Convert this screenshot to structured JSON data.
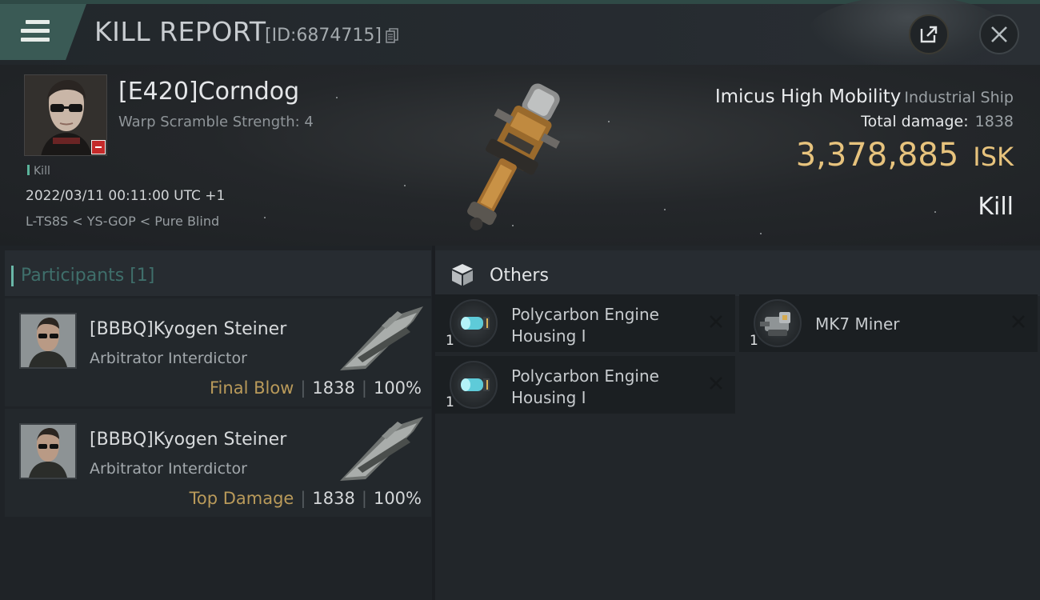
{
  "header": {
    "title": "KILL REPORT",
    "report_id": "[ID:6874715]"
  },
  "victim": {
    "name": "[E420]Corndog",
    "subtitle": "Warp Scramble Strength: 4",
    "tag": "Kill",
    "timestamp": "2022/03/11 00:11:00 UTC +1",
    "location": "L-TS8S < YS-GOP < Pure Blind"
  },
  "ship": {
    "name": "Imicus High Mobility",
    "class": "Industrial Ship",
    "total_damage_label": "Total damage:",
    "total_damage": "1838",
    "value": "3,378,885",
    "currency": "ISK",
    "result": "Kill"
  },
  "participants": {
    "title": "Participants [1]",
    "rows": [
      {
        "name": "[BBBQ]Kyogen Steiner",
        "ship": "Arbitrator Interdictor",
        "tag": "Final Blow",
        "damage": "1838",
        "percent": "100%"
      },
      {
        "name": "[BBBQ]Kyogen Steiner",
        "ship": "Arbitrator Interdictor",
        "tag": "Top Damage",
        "damage": "1838",
        "percent": "100%"
      }
    ]
  },
  "others": {
    "title": "Others",
    "items": [
      {
        "name": "Polycarbon Engine Housing I",
        "qty": "1",
        "icon": "engine-housing-icon"
      },
      {
        "name": "Polycarbon Engine Housing I",
        "qty": "1",
        "icon": "engine-housing-icon"
      },
      {
        "name": "MK7 Miner",
        "qty": "1",
        "icon": "mining-laser-icon"
      }
    ]
  },
  "colors": {
    "accent_teal": "#6ab7a8",
    "isk_gold": "#e7c37d",
    "tag_gold": "#b99a5a",
    "security_red": "#c52a2a"
  }
}
